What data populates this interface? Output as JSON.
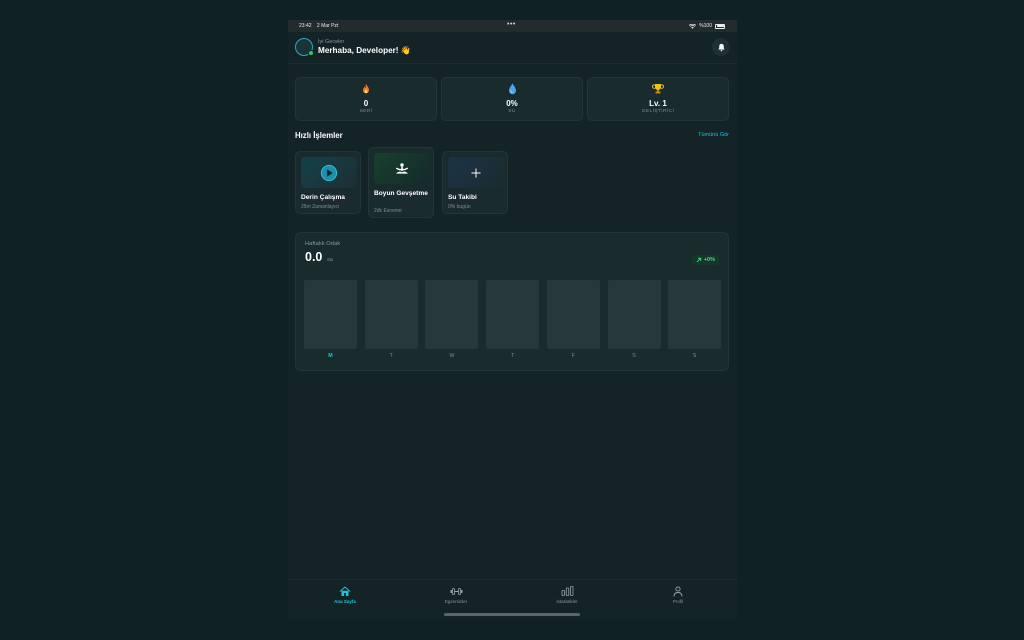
{
  "statusbar": {
    "time": "23:42",
    "date": "2 Mar Pzt",
    "dots": "•••",
    "battery": "%100"
  },
  "header": {
    "subtitle": "İyi Geceler",
    "greeting": "Merhaba, Developer! 👋"
  },
  "stats": [
    {
      "icon": "flame-icon",
      "value": "0",
      "label": "SERİ",
      "color": "#f07a1f"
    },
    {
      "icon": "water-drop-icon",
      "value": "0%",
      "label": "SU",
      "color": "#4aa3f0"
    },
    {
      "icon": "trophy-icon",
      "value": "Lv. 1",
      "label": "GELİŞTİRİCİ",
      "color": "#f2c21b"
    }
  ],
  "quick_actions": {
    "title": "Hızlı İşlemler",
    "see_all": "Tümünü Gör",
    "items": [
      {
        "title": "Derin Çalışma",
        "subtitle": "25m Zamanlayıcı",
        "icon": "play-icon"
      },
      {
        "title": "Boyun Gevşetme",
        "subtitle": "2dk Esneme",
        "icon": "meditation-icon"
      },
      {
        "title": "Su Takibi",
        "subtitle": "0% bugün",
        "icon": "plus-icon"
      }
    ]
  },
  "weekly": {
    "title": "Haftalık Odak",
    "value": "0.0",
    "unit": "sa",
    "trend": "+0%",
    "days": [
      "M",
      "T",
      "W",
      "T",
      "F",
      "S",
      "S"
    ],
    "active_day": 0,
    "hours": [
      0,
      0,
      0,
      0,
      0,
      0,
      0
    ]
  },
  "tabbar": {
    "items": [
      {
        "label": "Ana Sayfa",
        "icon": "home-icon"
      },
      {
        "label": "Egzersizler",
        "icon": "dumbbell-icon"
      },
      {
        "label": "İstatistikler",
        "icon": "stats-icon"
      },
      {
        "label": "Profil",
        "icon": "profile-icon"
      }
    ],
    "active": 0
  },
  "colors": {
    "accent": "#1ec3e0",
    "success": "#3fe08c",
    "background": "#0f2124"
  }
}
